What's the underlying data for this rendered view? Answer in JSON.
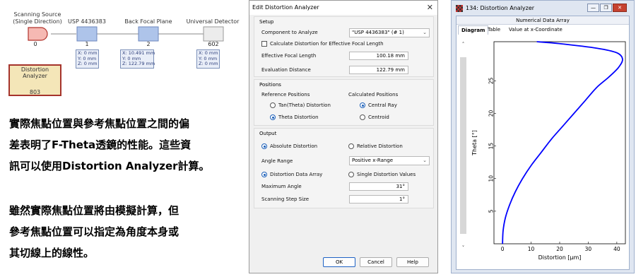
{
  "diagram": {
    "components": [
      {
        "label": "Scanning Source (Single Direction)",
        "number": "0"
      },
      {
        "label": "USP 4436383",
        "number": "1"
      },
      {
        "label": "Back Focal Plane",
        "number": "2"
      },
      {
        "label": "Universal Detector",
        "number": "602"
      }
    ],
    "coords": [
      {
        "x": "X: 0 mm",
        "y": "Y: 0 mm",
        "z": "Z: 0 mm"
      },
      {
        "x": "X: 10.491 mm",
        "y": "Y: 0 mm",
        "z": "Z: 122.79 mm"
      },
      {
        "x": "X: 0 mm",
        "y": "Y: 0 mm",
        "z": "Z: 0 mm"
      }
    ],
    "analyzer": {
      "label": "Distortion Analyzer",
      "number": "803"
    },
    "colors": {
      "source": "#f6b9b3",
      "source_border": "#b1332c",
      "lens": "#aec4ea",
      "analyzer_border": "#a5332b",
      "analyzer_fill": "#f4e6b8",
      "hexagon": "#c7a65b"
    }
  },
  "paragraph1": [
    "實際焦點位置與參考焦點位置之間的偏",
    "差表明了F-Theta透鏡的性能。這些資",
    "訊可以使用Distortion Analyzer計算。"
  ],
  "paragraph2": [
    "雖然實際焦點位置將由模擬計算，但",
    "參考焦點位置可以指定為角度本身或",
    "其切線上的線性。"
  ],
  "dialog": {
    "title": "Edit Distortion Analyzer",
    "close_icon": "close-icon",
    "setup": {
      "title": "Setup",
      "component_label": "Component to Analyze",
      "component_value": "\"USP 4436383\" (# 1)",
      "calc_checkbox_label": "Calculate Distortion for Effective Focal Length",
      "efl_label": "Effective Focal Length",
      "efl_value": "100.18 mm",
      "eval_label": "Evaluation Distance",
      "eval_value": "122.79 mm"
    },
    "positions": {
      "title": "Positions",
      "reference_title": "Reference Positions",
      "calculated_title": "Calculated Positions",
      "tan_label": "Tan(Theta) Distortion",
      "theta_label": "Theta Distortion",
      "central_ray_label": "Central Ray",
      "centroid_label": "Centroid"
    },
    "output": {
      "title": "Output",
      "absolute_label": "Absolute Distortion",
      "relative_label": "Relative Distortion",
      "angle_range_label": "Angle Range",
      "angle_range_value": "Positive x-Range",
      "data_array_label": "Distortion Data Array",
      "single_values_label": "Single Distortion Values",
      "max_angle_label": "Maximum Angle",
      "max_angle_value": "31°",
      "step_label": "Scanning Step Size",
      "step_value": "1°"
    },
    "buttons": {
      "ok": "OK",
      "cancel": "Cancel",
      "help": "Help"
    }
  },
  "window": {
    "title": "134: Distortion Analyzer",
    "header": "Numerical Data Array",
    "tabs": [
      "Diagram",
      "Table",
      "Value at x-Coordinate"
    ],
    "controls": {
      "minimize": "—",
      "restore": "❐",
      "close": "✕"
    }
  },
  "chart_data": {
    "type": "line",
    "xlabel": "Distortion [μm]",
    "ylabel": "Theta [°]",
    "xlim": [
      -3,
      43
    ],
    "ylim": [
      0,
      31
    ],
    "xticks": [
      0,
      10,
      20,
      30,
      40
    ],
    "yticks": [
      5,
      10,
      15,
      20,
      25
    ],
    "series": [
      {
        "color": "#0000ff",
        "points": [
          [
            0,
            0
          ],
          [
            0.2,
            2
          ],
          [
            1,
            4
          ],
          [
            2.5,
            6
          ],
          [
            4.5,
            8
          ],
          [
            7,
            10
          ],
          [
            10,
            12
          ],
          [
            13.5,
            14
          ],
          [
            17,
            16
          ],
          [
            21,
            18
          ],
          [
            25,
            20
          ],
          [
            29,
            22
          ],
          [
            33,
            24
          ],
          [
            37,
            25.5
          ],
          [
            40.5,
            27
          ],
          [
            42,
            28.3
          ],
          [
            40,
            29.3
          ],
          [
            33,
            30
          ],
          [
            20,
            30.7
          ],
          [
            12,
            31
          ]
        ]
      }
    ]
  }
}
